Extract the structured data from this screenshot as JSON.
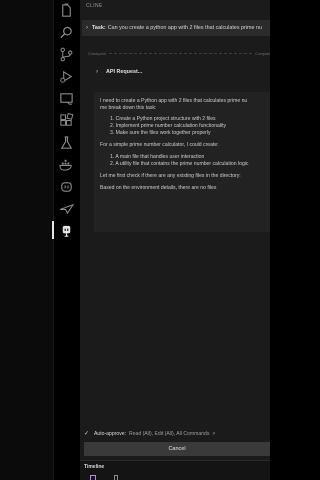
{
  "panel": {
    "title": "CLINE"
  },
  "task": {
    "label": "Task:",
    "text": "Can you create a python app with 2 files that calculates prime nu"
  },
  "checkpoint": {
    "left": "Checkpoint",
    "right": "Compare"
  },
  "api_request": {
    "label": "API Request..."
  },
  "message": {
    "lines": [
      "I need to create a Python app with 2 files that calculates prime nu",
      "me break down this task:",
      "1. Create a Python project structure with 2 files",
      "2. Implement prime number calculation functionality",
      "3. Make sure the files work together properly",
      "For a simple prime number calculator, I could create:",
      "1. A main file that handles user interaction",
      "2. A utility file that contains the prime number calculation logic",
      "Let me first check if there are any existing files in the directory:",
      "Based on the environment details, there are no files"
    ]
  },
  "auto_approve": {
    "check": "✓",
    "label": "Auto-approve:",
    "value": "Read (All), Edit (All), All Commands",
    "chevron": ">"
  },
  "cancel_button": {
    "label": "Cancel"
  },
  "timeline": {
    "label": "Timeline"
  },
  "activity_icons": [
    "files-icon",
    "search-icon",
    "source-control-icon",
    "run-debug-icon",
    "remote-explorer-icon",
    "extensions-icon",
    "testing-icon",
    "docker-icon",
    "copilot-icon",
    "deploy-icon",
    "cline-icon"
  ],
  "colors": {
    "activity_bg": "#0b0b0b",
    "panel_bg": "#1b1b1b",
    "task_bg": "#2b2b2b",
    "card_bg": "#222222",
    "button_bg": "#3a3a3a",
    "accent_purple": "#b48ae6"
  }
}
